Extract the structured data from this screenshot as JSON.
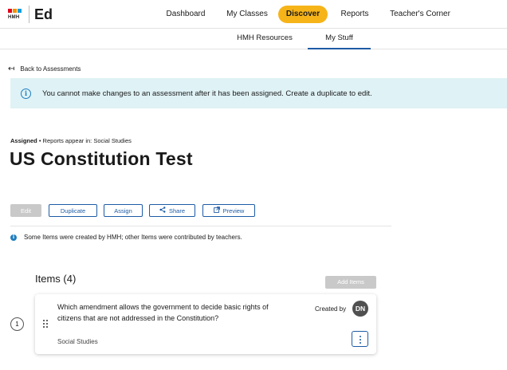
{
  "logo": {
    "brand": "HMH",
    "product": "Ed"
  },
  "topnav": {
    "items": [
      {
        "label": "Dashboard",
        "active": false
      },
      {
        "label": "My Classes",
        "active": false
      },
      {
        "label": "Discover",
        "active": true
      },
      {
        "label": "Reports",
        "active": false
      },
      {
        "label": "Teacher's Corner",
        "active": false
      }
    ]
  },
  "subnav": {
    "items": [
      {
        "label": "HMH Resources",
        "active": false
      },
      {
        "label": "My Stuff",
        "active": true
      }
    ]
  },
  "back_link": "Back to Assessments",
  "alert": {
    "icon": "info-icon",
    "text": "You cannot make changes to an assessment after it has been assigned. Create a duplicate to edit."
  },
  "assessment": {
    "status": "Assigned",
    "meta": " • Reports appear in: Social Studies",
    "title": "US Constitution Test"
  },
  "actions": {
    "edit": "Edit",
    "duplicate": "Duplicate",
    "assign": "Assign",
    "share": "Share",
    "preview": "Preview"
  },
  "info_note": "Some Items were created by HMH; other Items were contributed by teachers.",
  "items_section": {
    "heading": "Items (4)",
    "add_button": "Add Items",
    "items": [
      {
        "number": "1",
        "question": "Which amendment allows the government to decide basic rights of citizens that are not addressed in the Constitution?",
        "subject": "Social Studies",
        "created_by_label": "Created by",
        "creator_initials": "DN"
      }
    ]
  },
  "colors": {
    "accent": "#f6b419",
    "primary": "#1d5ba5",
    "alert_bg": "#dff2f6",
    "disabled": "#c9c9c9"
  }
}
